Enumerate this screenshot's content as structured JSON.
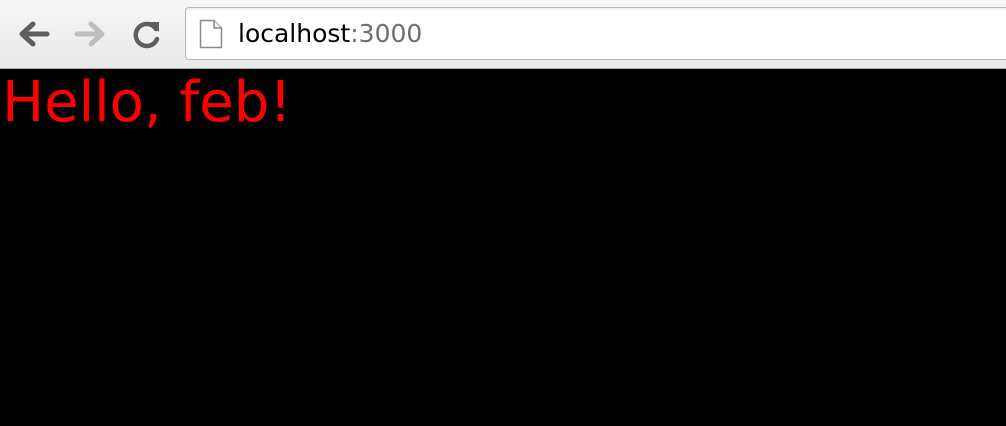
{
  "browser": {
    "url": {
      "host": "localhost",
      "port_part": ":3000"
    },
    "icons": {
      "back": "back-arrow-icon",
      "forward": "forward-arrow-icon",
      "reload": "reload-icon",
      "page": "page-icon"
    }
  },
  "page": {
    "heading": "Hello, feb!",
    "background_color": "#000000",
    "heading_color": "#ff0000"
  }
}
